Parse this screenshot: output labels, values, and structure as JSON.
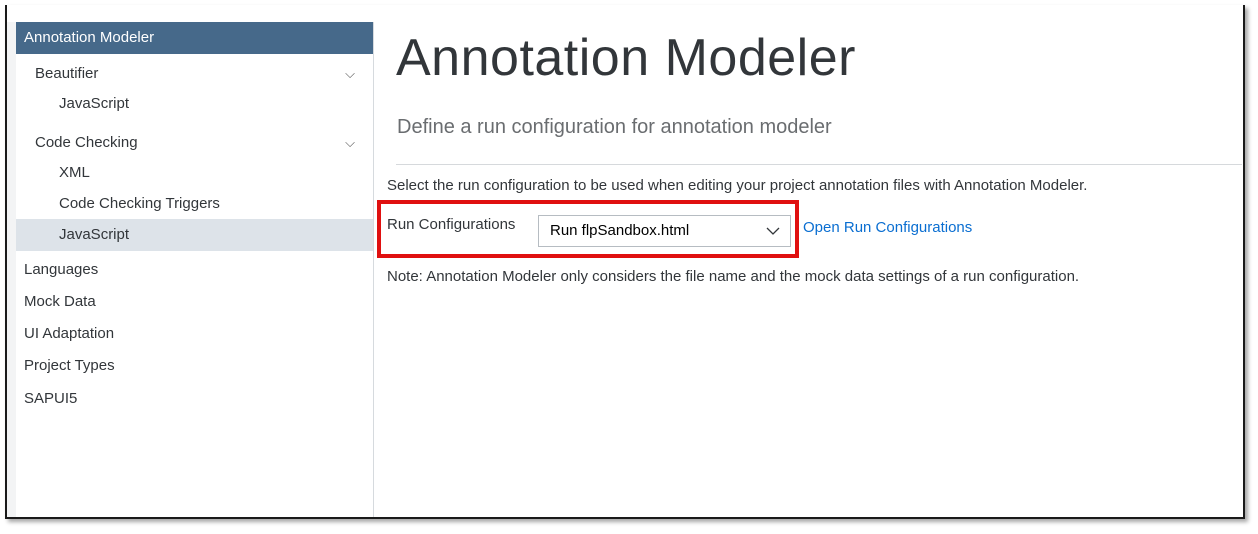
{
  "sidebar": {
    "header": "Annotation Modeler",
    "groups": [
      {
        "label": "Beautifier",
        "children": [
          "JavaScript"
        ]
      },
      {
        "label": "Code Checking",
        "children": [
          "XML",
          "Code Checking Triggers",
          "JavaScript"
        ]
      }
    ],
    "items": [
      "Languages",
      "Mock Data",
      "UI Adaptation",
      "Project Types",
      "SAPUI5"
    ]
  },
  "main": {
    "title": "Annotation Modeler",
    "subtitle": "Define a run configuration for annotation modeler",
    "description": "Select the run configuration to be used when editing your project annotation files with Annotation Modeler.",
    "run_label": "Run Configurations",
    "run_select_value": "Run flpSandbox.html",
    "open_link": "Open Run Configurations",
    "note": "Note: Annotation Modeler only considers the file name and the mock data settings of a run configuration."
  },
  "colors": {
    "active_item_bg": "#46698a",
    "selected_item_bg": "#dde3e9",
    "link": "#0a6ed1",
    "highlight_border": "#e01010"
  }
}
